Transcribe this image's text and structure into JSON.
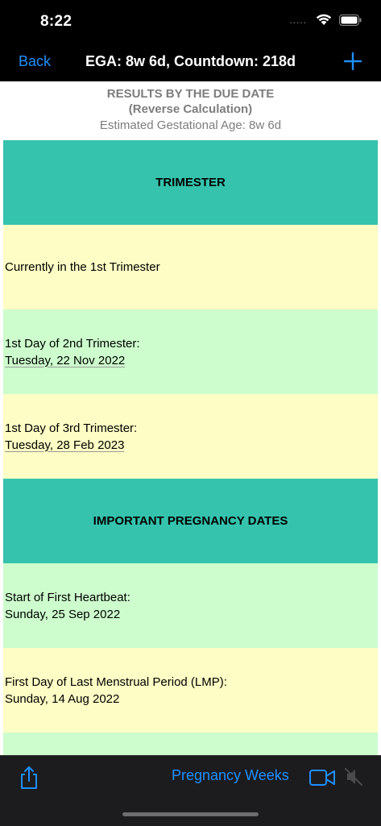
{
  "status": {
    "time": "8:22",
    "dots": "....."
  },
  "nav": {
    "back_label": "Back",
    "title": "EGA: 8w 6d, Countdown: 218d"
  },
  "results": {
    "title": "RESULTS BY THE DUE DATE",
    "subtitle": "(Reverse Calculation)",
    "ega": "Estimated Gestational Age: 8w 6d"
  },
  "rows": {
    "trimester_header": "TRIMESTER",
    "current_trimester": "Currently in the 1st Trimester",
    "second_tri_label": "1st Day of 2nd Trimester:",
    "second_tri_date": "Tuesday, 22 Nov 2022",
    "third_tri_label": "1st Day of 3rd Trimester:",
    "third_tri_date": "Tuesday, 28 Feb 2023",
    "important_header": "IMPORTANT PREGNANCY DATES",
    "heartbeat_label": "Start of First Heartbeat:",
    "heartbeat_date": "Sunday, 25 Sep 2022",
    "lmp_label": "First Day of Last Menstrual Period (LMP):",
    "lmp_date": "Sunday, 14 Aug 2022"
  },
  "toolbar": {
    "weeks_label": "Pregnancy Weeks"
  },
  "colors": {
    "accent_blue": "#1f8fff",
    "header_teal": "#35c3ae",
    "row_yellow": "#fdfdc5",
    "row_green": "#cdfdcd"
  },
  "icons": [
    "wifi-icon",
    "battery-icon",
    "plus-icon",
    "share-icon",
    "video-icon",
    "mute-icon"
  ]
}
